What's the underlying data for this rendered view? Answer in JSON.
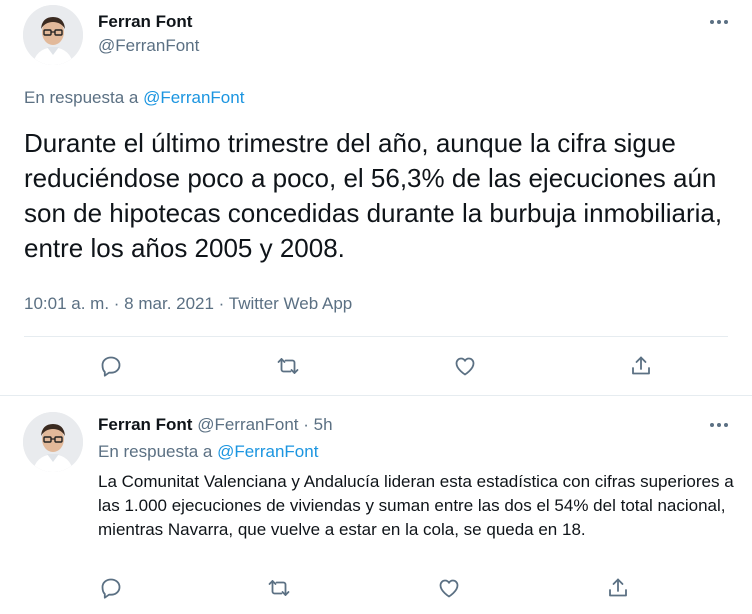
{
  "main_tweet": {
    "author_name": "Ferran Font",
    "author_handle": "@FerranFont",
    "reply_prefix": "En respuesta a ",
    "reply_mention": "@FerranFont",
    "text": "Durante el último trimestre del año, aunque la cifra sigue reduciéndose poco a poco, el 56,3% de las ejecuciones aún son de hipotecas concedidas durante la burbuja inmobiliaria, entre los años 2005 y 2008.",
    "time": "10:01 a. m.",
    "separator": " · ",
    "date": "8 mar. 2021",
    "source": "Twitter Web App"
  },
  "reply_tweet": {
    "author_name": "Ferran Font",
    "author_handle": "@FerranFont",
    "separator": " · ",
    "time_ago": "5h",
    "reply_prefix": "En respuesta a ",
    "reply_mention": "@FerranFont",
    "text": "La Comunitat Valenciana y Andalucía lideran esta estadística con cifras superiores a las 1.000 ejecuciones de viviendas y suman entre las dos el 54% del total nacional, mientras Navarra, que vuelve a estar en la cola, se queda en 18."
  },
  "icons": {
    "reply": "reply-icon",
    "retweet": "retweet-icon",
    "like": "like-icon",
    "share": "share-icon",
    "more": "more-icon"
  },
  "colors": {
    "accent": "#1b95e0",
    "muted": "#5b7083",
    "text": "#0f1419",
    "border": "#e6ecf0"
  }
}
